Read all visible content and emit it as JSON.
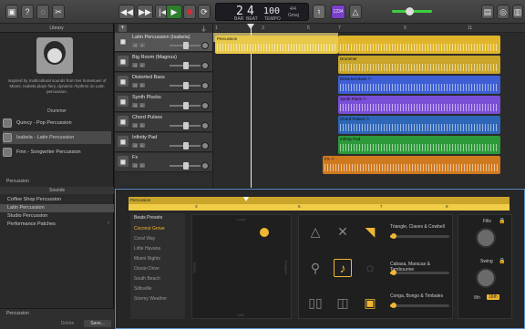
{
  "toolbar": {
    "lcd": {
      "bar": "2",
      "beat": "4",
      "bar_label": "BAR",
      "beat_label": "BEAT",
      "tempo": "100",
      "tempo_label": "TEMPO",
      "signature": "4/4",
      "key": "Gmaj"
    },
    "count_in": "1234",
    "colors": {
      "play": "#2f7d2f",
      "record": "#d23030",
      "accent_purple": "#7a3fc9"
    }
  },
  "library": {
    "title": "Library",
    "drummer_bio": "Inspired by multicultural sounds from her hometown of Miami, Isabela plays fiery, dynamic rhythms on Latin percussion.",
    "drummer_label": "Drummer",
    "drummers": [
      {
        "name": "Quincy - Pop Percussion"
      },
      {
        "name": "Isabela - Latin Percussion"
      },
      {
        "name": "Finn - Songwriter Percussion"
      }
    ],
    "category": "Percussion",
    "sounds_label": "Sounds",
    "sounds": [
      "Coffee Shop Percussion",
      "Latin Percussion",
      "Studio Percussion",
      "Performance Patches"
    ],
    "footer_category": "Percussion",
    "delete_label": "Delete",
    "save_label": "Save..."
  },
  "tracks": [
    {
      "name": "Latin Percussion (Isabela)",
      "icon": "drummer-icon",
      "color": "#c9a52a"
    },
    {
      "name": "Big Room (Magnus)",
      "icon": "drums-icon",
      "color": "#c9a52a"
    },
    {
      "name": "Distorted Bass",
      "icon": "bass-keyboard-icon",
      "color": "#3a5ac9"
    },
    {
      "name": "Synth Plucks",
      "icon": "keyboard-icon",
      "color": "#6b4ad0"
    },
    {
      "name": "Chord Pulses",
      "icon": "keyboard-icon",
      "color": "#2e66b8"
    },
    {
      "name": "Infinity Pad",
      "icon": "keyboard-icon",
      "color": "#2d9a3a"
    },
    {
      "name": "Fx",
      "icon": "fx-icon",
      "color": "#d07a20"
    }
  ],
  "ruler": [
    "1",
    "3",
    "5",
    "7",
    "9",
    "11"
  ],
  "regions": [
    {
      "label": "Percussion",
      "color": "#e8c94a"
    },
    {
      "label": "",
      "color": "#e0b52a"
    },
    {
      "label": "Drummer",
      "color": "#c9a52a"
    },
    {
      "label": "Distorted Bass ♾",
      "color": "#3d5fd3"
    },
    {
      "label": "Synth Pluck ♾",
      "color": "#7a4fd8"
    },
    {
      "label": "Chord Pulses ♾",
      "color": "#2e66b8"
    },
    {
      "label": "Infinity Pad",
      "color": "#2d9a3a"
    },
    {
      "label": "FX ♾",
      "color": "#d07a20"
    }
  ],
  "editor": {
    "region_label": "Percussion",
    "ruler": [
      "3",
      "5",
      "7",
      "9"
    ],
    "presets_title": "Beats Presets",
    "presets": [
      "Coconut Grove",
      "Coral Way",
      "Little Havana",
      "Miami Nights",
      "Ocean Drive",
      "South Beach",
      "Stiltsville",
      "Stormy Weather"
    ],
    "pad_top": "Loud",
    "pad_bottom": "Soft",
    "pad_left": "Simple",
    "pad_right": "Complex",
    "groups": [
      {
        "label": "Triangle, Claves & Cowbell",
        "value": 0.05
      },
      {
        "label": "Cabasa, Maracas & Tambourine",
        "value": 0.05
      },
      {
        "label": "Conga, Bongo & Timbales",
        "value": 0.05
      }
    ],
    "fills_label": "Fills",
    "swing_label": "Swing",
    "swing_8th": "8th",
    "swing_16th": "16th",
    "accent": "#f0b732"
  }
}
